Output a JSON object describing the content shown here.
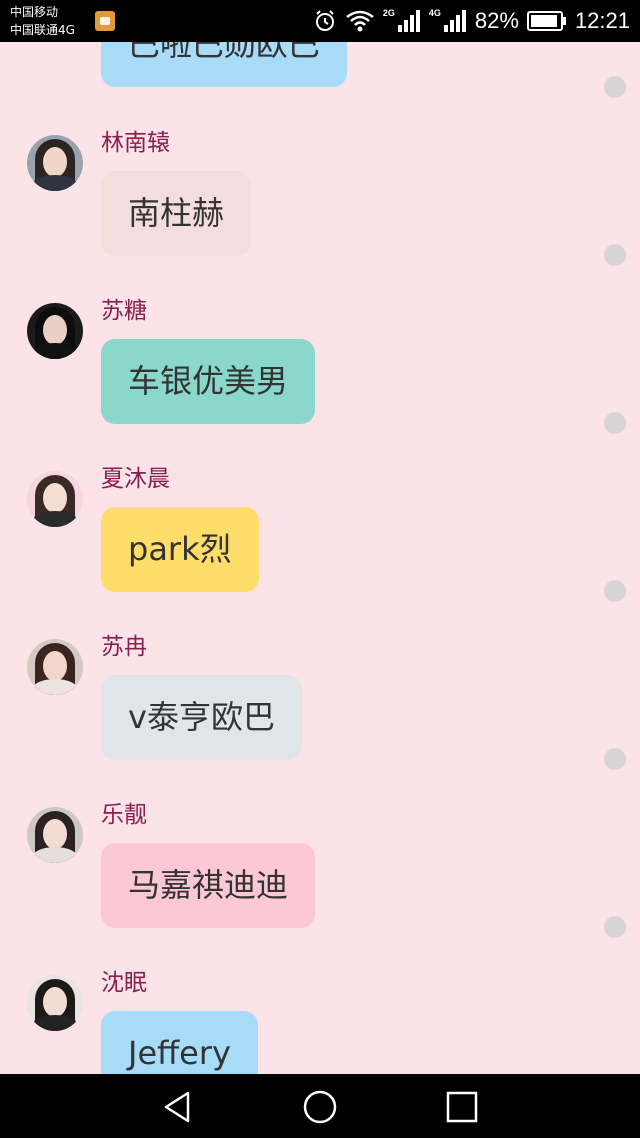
{
  "status_bar": {
    "carrier_1": "中国移动",
    "carrier_2": "中国联通4G",
    "network_1": "2G",
    "network_2": "4G",
    "battery": "82%",
    "time": "12:21",
    "icons": [
      "alarm-icon",
      "wifi-icon",
      "signal-icon",
      "battery-icon"
    ]
  },
  "chat": {
    "partial_top_message": "巴啦巴勋欧巴",
    "messages": [
      {
        "name": "林南辕",
        "text": "南柱赫",
        "bubble_color": "#f3dedd"
      },
      {
        "name": "苏糖",
        "text": "车银优美男",
        "bubble_color": "#8ad8cc"
      },
      {
        "name": "夏沐晨",
        "text": "park烈",
        "bubble_color": "#ffdd6b"
      },
      {
        "name": "苏冉",
        "text": "v泰亨欧巴",
        "bubble_color": "#e1e5ea"
      },
      {
        "name": "乐靓",
        "text": "马嘉祺迪迪",
        "bubble_color": "#fdc8d6"
      },
      {
        "name": "沈眠",
        "text": "Jeffery",
        "bubble_color": "#a8dbf7"
      }
    ],
    "name_color": "#8a1f4f",
    "background": "#fbe3e8"
  },
  "nav_bar": {
    "back": "back-icon",
    "home": "home-icon",
    "recents": "recents-icon"
  }
}
